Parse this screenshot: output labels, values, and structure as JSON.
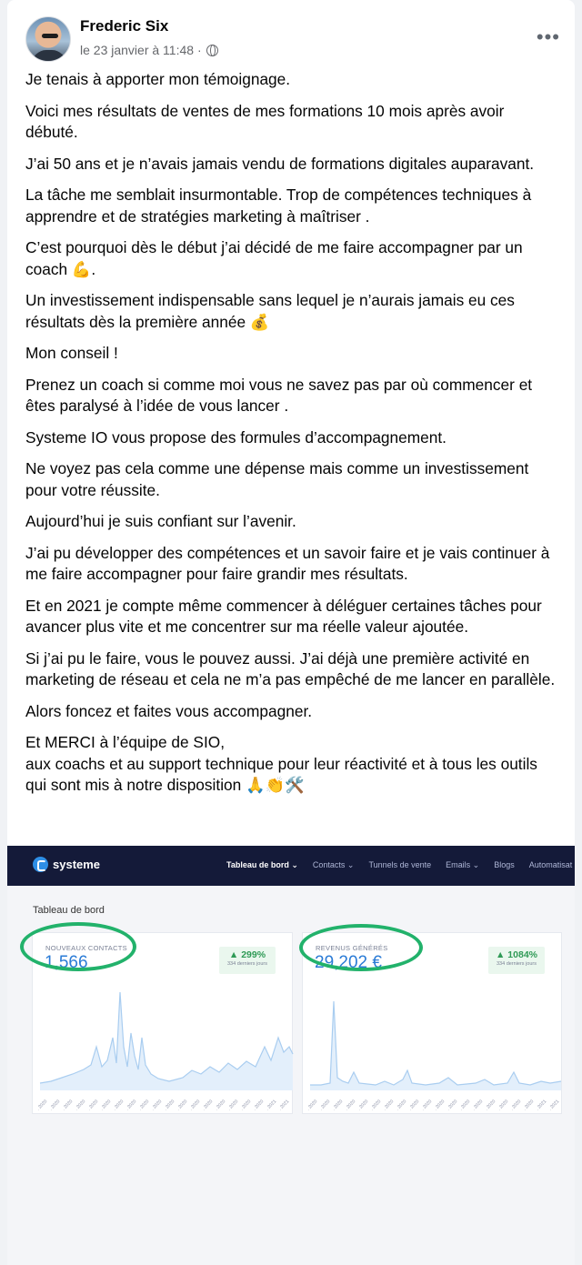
{
  "post": {
    "author": "Frederic Six",
    "timestamp": "le 23 janvier à 11:48 ·",
    "more_label": "•••",
    "paragraphs": [
      "Je tenais à apporter mon témoignage.",
      "Voici mes résultats de ventes de mes formations 10 mois après avoir débuté.",
      "J’ai 50 ans et je n’avais jamais vendu de formations digitales auparavant.",
      "La tâche me semblait insurmontable. Trop de compétences techniques à apprendre et de stratégies marketing à maîtriser .",
      "C’est pourquoi dès le début j’ai décidé de me faire accompagner par un coach 💪.",
      "Un investissement indispensable sans lequel je n’aurais jamais eu ces résultats dès la première année 💰",
      "Mon conseil !",
      "Prenez un coach si comme moi vous ne savez pas par où commencer et êtes paralysé à l’idée de vous lancer .",
      "Systeme IO vous propose des formules d’accompagnement.",
      "Ne voyez pas cela comme une dépense mais comme un investissement pour votre réussite.",
      "Aujourd’hui je suis confiant sur l’avenir.",
      "J’ai pu développer des compétences et un savoir faire et je vais continuer à me faire accompagner pour faire grandir mes résultats.",
      "Et en 2021 je compte même commencer à déléguer certaines tâches pour avancer plus vite et me concentrer sur ma réelle valeur ajoutée.",
      "Si j’ai pu le faire, vous le pouvez aussi. J’ai déjà une première activité en marketing de réseau et cela ne m’a pas empêché de me lancer en parallèle.",
      "Alors foncez et faites vous accompagner.",
      "Et MERCI à l’équipe de SIO,",
      "aux coachs et au support technique pour leur réactivité et à tous les outils qui sont mis à notre disposition 🙏👏🛠️"
    ]
  },
  "screenshot": {
    "brand": "systeme",
    "nav": [
      "Tableau de bord ⌄",
      "Contacts ⌄",
      "Tunnels de vente",
      "Emails ⌄",
      "Blogs",
      "Automatisat"
    ],
    "dashboard_title": "Tableau de bord",
    "contacts_card": {
      "label": "NOUVEAUX CONTACTS",
      "value": "1,566",
      "change": "▲ 299%",
      "period": "334 derniers jours"
    },
    "revenue_card": {
      "label": "REVENUS GÉNÉRÉS",
      "value": "29,202 €",
      "change": "▲ 1084%",
      "period": "334 derniers jours"
    },
    "colors": {
      "nav_bg": "#141a39",
      "accent": "#2a7bd6",
      "highlight_ring": "#22b26b",
      "badge_text": "#2f9a56",
      "chart_line": "#a9cdf0"
    }
  }
}
